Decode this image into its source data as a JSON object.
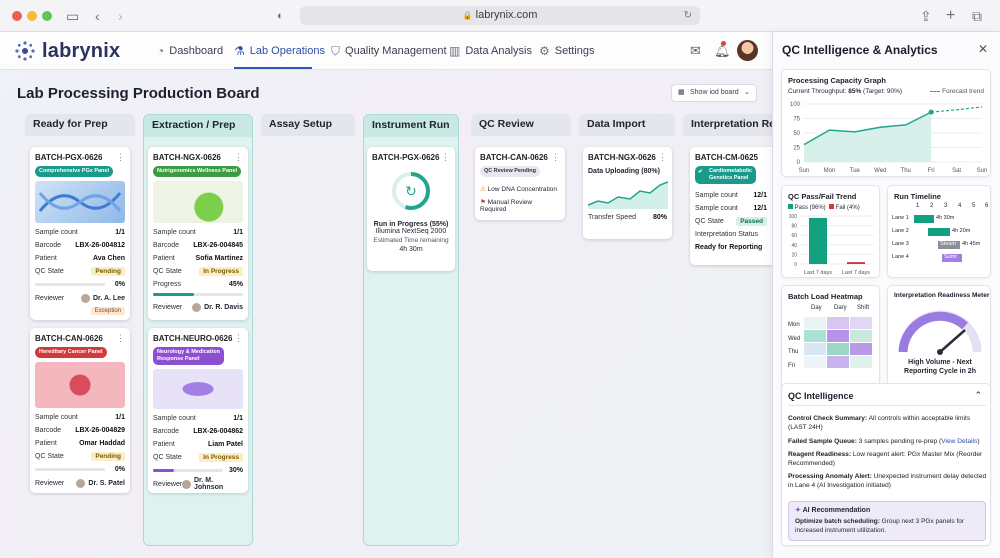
{
  "browser": {
    "url": "labrynix.com"
  },
  "app": {
    "logo": "labrynix",
    "nav": [
      {
        "label": "Dashboard",
        "icon": "gauge-icon"
      },
      {
        "label": "Lab Operations",
        "icon": "flask-icon"
      },
      {
        "label": "Quality Management",
        "icon": "shield-check-icon"
      },
      {
        "label": "Data Analysis",
        "icon": "bar-chart-icon"
      },
      {
        "label": "Settings",
        "icon": "gear-icon"
      }
    ],
    "active_nav": "Lab Operations"
  },
  "board": {
    "title": "Lab Processing Production Board",
    "show_btn": "Show iod board",
    "columns": [
      "Ready for Prep",
      "Extraction / Prep",
      "Assay Setup",
      "Instrument Run",
      "QC Review",
      "Data Import",
      "Interpretation Rea"
    ]
  },
  "cards": {
    "c1": {
      "id": "BATCH-PGX-0626",
      "tag": "Comprehensive PGx Panel",
      "sample_k": "Sample count",
      "sample": "1/1",
      "barcode_k": "Barcode",
      "barcode": "LBX-26-004812",
      "patient_k": "Patient",
      "patient": "Ava Chen",
      "qc_k": "QC State",
      "qc": "Pending",
      "pct": "0%",
      "progress": 0,
      "reviewer_k": "Reviewer",
      "reviewer": "Dr. A. Lee",
      "exception": "Exception"
    },
    "c2": {
      "id": "BATCH-CAN-0626",
      "tag": "Hereditary Cancer Panel",
      "sample_k": "Sample count",
      "sample": "1/1",
      "barcode_k": "Barcode",
      "barcode": "LBX-26-004829",
      "patient_k": "Patient",
      "patient": "Omar Haddad",
      "qc_k": "QC State",
      "qc": "Pending",
      "pct": "0%",
      "progress": 0,
      "reviewer_k": "Reviewer",
      "reviewer": "Dr. S. Patel"
    },
    "c3": {
      "id": "BATCH-NGX-0626",
      "tag": "Nutrigenomics Wellness Panel",
      "sample_k": "Sample count",
      "sample": "1/1",
      "barcode_k": "Barcode",
      "barcode": "LBX-26-004845",
      "patient_k": "Patient",
      "patient": "Sofia Martinez",
      "qc_k": "QC State",
      "qc": "In Progress",
      "prog_k": "Progress",
      "pct": "45%",
      "progress": 45,
      "reviewer_k": "Reviewer",
      "reviewer": "Dr. R. Davis"
    },
    "c4": {
      "id": "BATCH-NEURO-0626",
      "tag1": "Neurology & Medication",
      "tag2": "Response Panel",
      "sample_k": "Sample count",
      "sample": "1/1",
      "barcode_k": "Barcode",
      "barcode": "LBX-26-004862",
      "patient_k": "Patient",
      "patient": "Liam Patel",
      "qc_k": "QC State",
      "qc": "In Progress",
      "pct": "30%",
      "progress": 30,
      "reviewer_k": "Reviewer",
      "reviewer": "Dr. M. Johnson"
    },
    "c5": {
      "id": "BATCH-PGX-0626",
      "line1": "Run in Progress (55%)",
      "progress": 55,
      "line2": "Illumina NextSeq 2000",
      "line3": "Estimated Time remaining",
      "line4": "4h 30m"
    },
    "c6": {
      "id": "BATCH-CAN-0626",
      "tag": "QC Review Pending",
      "alert1": "Low DNA Concentration",
      "alert2": "Manual Review Required"
    },
    "c7": {
      "id": "BATCH-NGX-0626",
      "status": "Data Uploading (80%)",
      "progress": 80,
      "speed_k": "Transfer Speed",
      "speed": "80%"
    },
    "c8": {
      "id": "BATCH-CM-0625",
      "tag1": "Cardiometabolic",
      "tag2": "Genetics Panel",
      "sample_k": "Sample count",
      "sample": "12/1",
      "sample2_k": "Sample count",
      "sample2": "12/1",
      "qc_k": "QC State",
      "qc": "Passed",
      "interp_k": "Interpretation Status",
      "interp": "Ready for Reporting"
    }
  },
  "panel": {
    "title": "QC Intelligence & Analytics",
    "capacity": {
      "title": "Processing Capacity Graph",
      "subtitle_a": "Current Throughput: ",
      "subtitle_b": "85%",
      "subtitle_c": " (Target: 90%)",
      "legend": "Forecast trend"
    },
    "passfail": {
      "title": "QC Pass/Fail Trend",
      "pass": "Pass (96%)",
      "fail": "Fail (4%)",
      "x1": "Last 7 days",
      "x2": "Last 7 days"
    },
    "timeline": {
      "title": "Run Timeline",
      "ticks": [
        "1",
        "2",
        "3",
        "4",
        "5",
        "6"
      ],
      "lanes": [
        {
          "label": "Lane 1",
          "dur": "4h 30m"
        },
        {
          "label": "Lane 2",
          "dur": "4h 20m"
        },
        {
          "label": "Lane 3",
          "name": "Steam",
          "dur": "4h 45m"
        },
        {
          "label": "Lane 4",
          "name": "Sumr"
        }
      ]
    },
    "heatmap": {
      "title": "Batch Load Heatmap",
      "cols": [
        "Day",
        "Dary",
        "Shift"
      ],
      "rows": [
        "Mon",
        "Wed",
        "Thu",
        "Fri"
      ]
    },
    "readiness": {
      "title": "Interpretation Readiness Meter",
      "label1": "High Volume - Next",
      "label2": "Reporting Cycle in 2h"
    },
    "qc": {
      "title": "QC Intelligence",
      "items": [
        {
          "k": "Control Check Summary:",
          "v": " All controls within acceptable limits (LAST 24H)"
        },
        {
          "k": "Failed Sample Queue:",
          "v": " 3 samples pending re-prep (",
          "link": "View Details",
          "end": ")"
        },
        {
          "k": "Reagent Readiness:",
          "v": " Low reagent alert: PGx Master Mix (Reorder Recommended)"
        },
        {
          "k": "Processing Anomaly Alert:",
          "v": " Unexpected instrument delay detected in Lane 4 (AI Investigation initiated)"
        }
      ],
      "ai_title": "AI Recommendation",
      "ai_k": "Optimize batch scheduling:",
      "ai_v": " Group next 3 PGx panels for increased instrument utilization."
    }
  },
  "chart_data": [
    {
      "type": "area",
      "title": "Processing Capacity Graph",
      "categories": [
        "Sun",
        "Mon",
        "Tue",
        "Wed",
        "Thu",
        "Fri",
        "Sat",
        "Sun"
      ],
      "ylim": [
        0,
        100
      ],
      "yticks": [
        0,
        25,
        50,
        75,
        100
      ],
      "series": [
        {
          "values": [
            30,
            55,
            52,
            60,
            64,
            86,
            null,
            null
          ]
        },
        {
          "name": "Forecast trend",
          "values": [
            null,
            null,
            null,
            null,
            null,
            86,
            90,
            95
          ]
        }
      ]
    },
    {
      "type": "bar",
      "title": "QC Pass/Fail Trend",
      "categories": [
        "Last 7 days",
        "Last 7 days"
      ],
      "yticks": [
        0,
        20,
        40,
        60,
        80,
        100
      ],
      "series": [
        {
          "name": "Pass (96%)",
          "values": [
            96,
            0
          ]
        },
        {
          "name": "Fail (4%)",
          "values": [
            0,
            4
          ]
        }
      ]
    }
  ]
}
